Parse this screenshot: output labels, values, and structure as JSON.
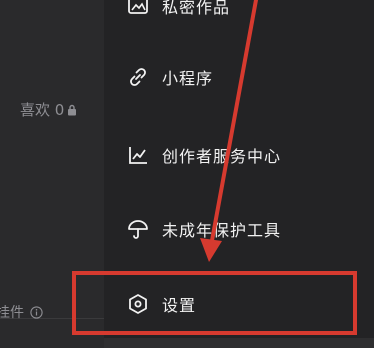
{
  "profile": {
    "likes_label": "喜欢 0",
    "widget_label": "挂件"
  },
  "menu": {
    "items": [
      {
        "label": "私密作品",
        "icon": "private-works-icon"
      },
      {
        "label": "小程序",
        "icon": "link-icon"
      },
      {
        "label": "创作者服务中心",
        "icon": "trend-chart-icon"
      },
      {
        "label": "未成年保护工具",
        "icon": "umbrella-icon"
      },
      {
        "label": "设置",
        "icon": "hexagon-settings-icon"
      }
    ]
  },
  "annotation": {
    "arrow_color": "#d63a2f",
    "highlight_color": "#d63a2f",
    "highlighted_item": "设置"
  },
  "colors": {
    "background": "#1c1c1e",
    "menu_background": "#232325",
    "text": "#f2f2f2",
    "muted_text": "#8e8e93"
  }
}
